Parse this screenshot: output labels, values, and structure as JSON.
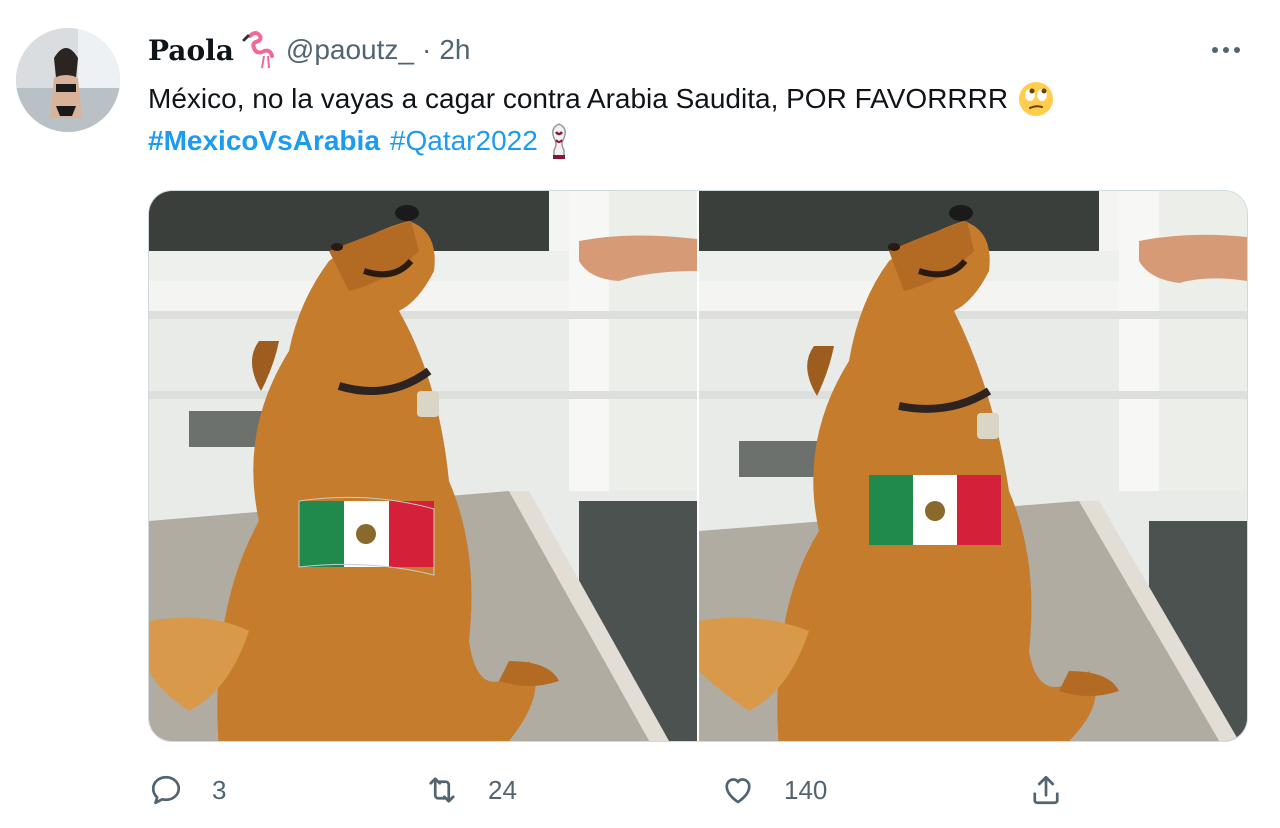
{
  "tweet": {
    "display_name": "Paola",
    "handle": "@paoutz_",
    "separator": "·",
    "time": "2h",
    "text_line1": "México, no la vayas a cagar contra Arabia Saudita, POR FAVORRRR",
    "hashtags": [
      "#MexicoVsArabia",
      "#Qatar2022"
    ],
    "emoji_names": [
      "flamingo-emoji",
      "rolling-eyes-emoji",
      "world-cup-trophy-emoji"
    ]
  },
  "media": {
    "photo_count": 2,
    "description_colors": {
      "fur": "#c8812f",
      "wall": "#e9ecea",
      "mat": "#a9a49a",
      "flag_green": "#1f8a4c",
      "flag_red": "#d5203a"
    }
  },
  "actions": {
    "reply_count": "3",
    "retweet_count": "24",
    "like_count": "140"
  },
  "colors": {
    "text": "#0f1419",
    "secondary": "#536471",
    "link": "#1d9bf0",
    "border": "#cfd9de"
  }
}
